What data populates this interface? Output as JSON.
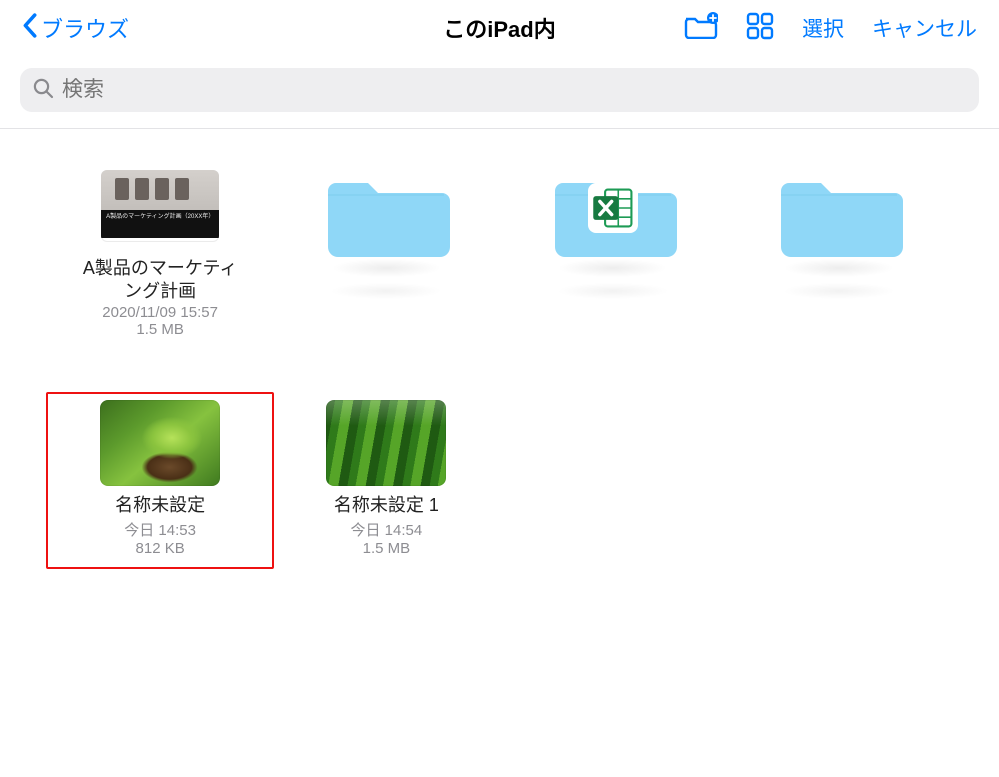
{
  "nav": {
    "back_label": "ブラウズ",
    "title": "このiPad内",
    "select_label": "選択",
    "cancel_label": "キャンセル"
  },
  "search": {
    "placeholder": "検索"
  },
  "items": [
    {
      "kind": "file",
      "thumb": "presentation",
      "name": "A製品のマーケティング計画",
      "date": "2020/11/09 15:57",
      "size": "1.5 MB",
      "caption": "A製品のマーケティング計画（20XX年）"
    },
    {
      "kind": "folder",
      "badge": null
    },
    {
      "kind": "folder",
      "badge": "excel"
    },
    {
      "kind": "folder",
      "badge": null
    },
    {
      "kind": "file",
      "thumb": "plant-a",
      "name": "名称未設定",
      "date": "今日 14:53",
      "size": "812 KB",
      "highlight": true
    },
    {
      "kind": "file",
      "thumb": "plant-b",
      "name": "名称未設定 1",
      "date": "今日 14:54",
      "size": "1.5 MB"
    }
  ],
  "colors": {
    "tint": "#007aff",
    "folder": "#8fd7f7"
  }
}
